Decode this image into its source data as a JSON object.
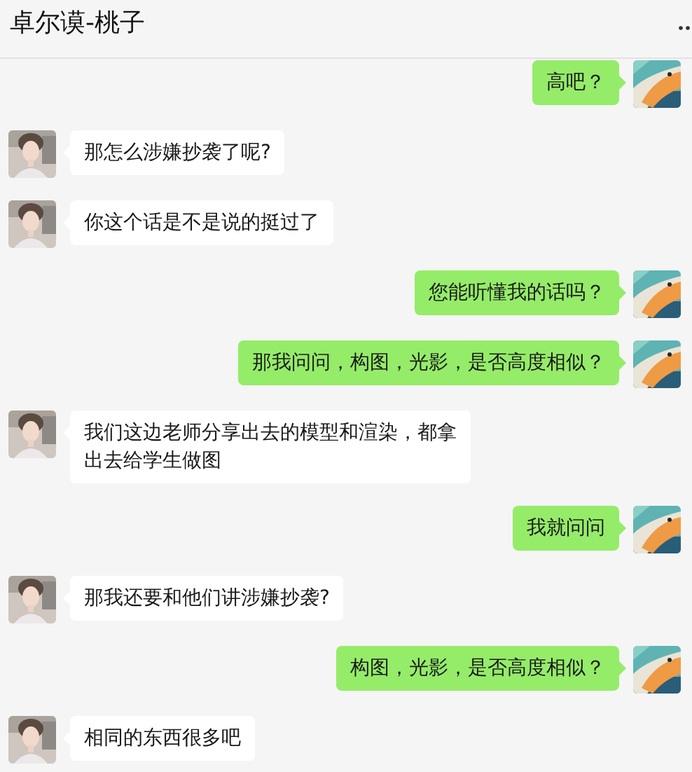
{
  "window": {
    "title": "卓尔谟-桃子"
  },
  "messages": [
    {
      "kind": "sent",
      "text": "高吧？"
    },
    {
      "kind": "received",
      "text": "那怎么涉嫌抄袭了呢?"
    },
    {
      "kind": "received",
      "text": "你这个话是不是说的挺过了"
    },
    {
      "kind": "sent",
      "text": "您能听懂我的话吗？"
    },
    {
      "kind": "sent",
      "text": "那我问问，构图，光影，是否高度相似？"
    },
    {
      "kind": "received",
      "text": "我们这边老师分享出去的模型和渲染，都拿出去给学生做图"
    },
    {
      "kind": "sent",
      "text": "我就问问"
    },
    {
      "kind": "received",
      "text": "那我还要和他们讲涉嫌抄袭?"
    },
    {
      "kind": "sent",
      "text": "构图，光影，是否高度相似？"
    },
    {
      "kind": "received",
      "text": "相同的东西很多吧"
    }
  ]
}
